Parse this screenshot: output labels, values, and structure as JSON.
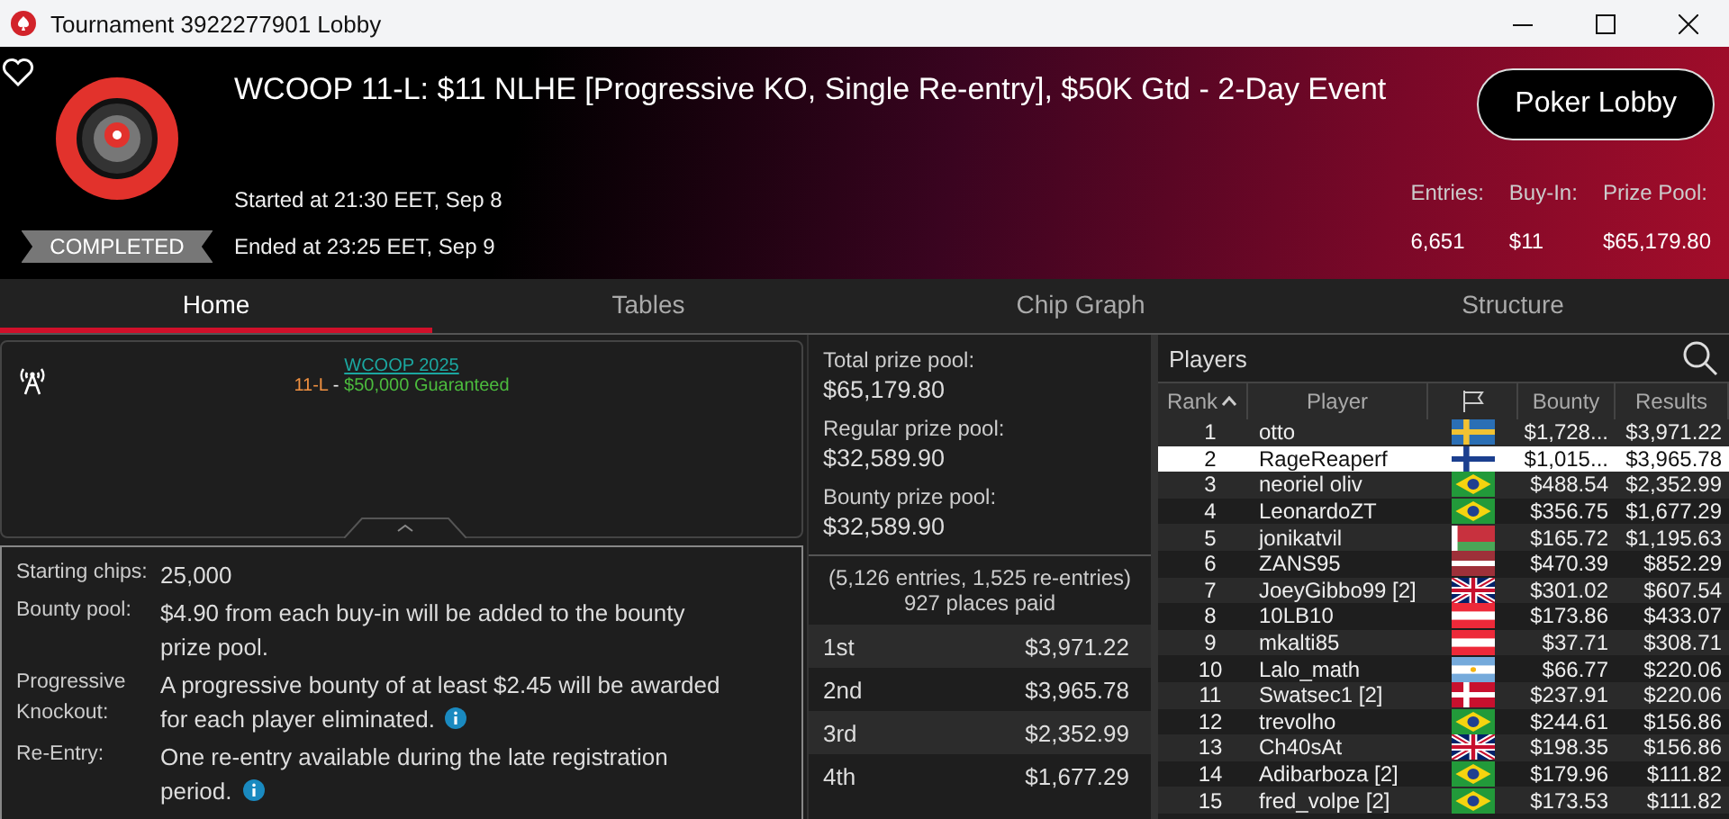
{
  "window": {
    "title": "Tournament 3922277901 Lobby"
  },
  "header": {
    "status": "COMPLETED",
    "title": "WCOOP 11-L: $11 NLHE [Progressive KO, Single Re-entry], $50K Gtd - 2-Day Event",
    "started": "Started at 21:30 EET, Sep 8",
    "ended": "Ended at 23:25 EET, Sep 9",
    "button": "Poker Lobby",
    "stats": [
      {
        "label": "Entries:",
        "value": "6,651"
      },
      {
        "label": "Buy-In:",
        "value": "$11"
      },
      {
        "label": "Prize Pool:",
        "value": "$65,179.80"
      }
    ]
  },
  "tabs": [
    {
      "label": "Home",
      "selected": true
    },
    {
      "label": "Tables",
      "selected": false
    },
    {
      "label": "Chip Graph",
      "selected": false
    },
    {
      "label": "Structure",
      "selected": false
    }
  ],
  "event": {
    "link": "WCOOP 2025",
    "subtitle": [
      {
        "kind": "code",
        "text": "11-L"
      },
      {
        "kind": "sep",
        "text": " - "
      },
      {
        "kind": "guarantee",
        "text": "$50,000 Guaranteed"
      }
    ]
  },
  "details": [
    {
      "label": "Starting chips:",
      "value": "25,000",
      "info": false
    },
    {
      "label": "Bounty pool:",
      "value": "$4.90 from each buy-in will be added to the bounty prize pool.",
      "info": false
    },
    {
      "label": "Progressive Knockout:",
      "value": "A progressive bounty of at least $2.45 will be awarded for each player eliminated.",
      "info": true
    },
    {
      "label": "Re-Entry:",
      "value": "One re-entry available during the late registration period.",
      "info": true
    }
  ],
  "prize_pools": [
    {
      "label": "Total prize pool:",
      "value": "$65,179.80"
    },
    {
      "label": "Regular prize pool:",
      "value": "$32,589.90"
    },
    {
      "label": "Bounty prize pool:",
      "value": "$32,589.90"
    }
  ],
  "entries_note": "(5,126 entries, 1,525 re-entries)",
  "places_paid": "927 places paid",
  "payouts": [
    {
      "place": "1st",
      "amount": "$3,971.22"
    },
    {
      "place": "2nd",
      "amount": "$3,965.78"
    },
    {
      "place": "3rd",
      "amount": "$2,352.99"
    },
    {
      "place": "4th",
      "amount": "$1,677.29"
    }
  ],
  "players": {
    "title": "Players",
    "columns": [
      "Rank",
      "Player",
      "Bounty",
      "Results"
    ],
    "rows": [
      {
        "rank": "1",
        "player": "otto",
        "kind": "se",
        "bounty": "$1,728...",
        "results": "$3,971.22",
        "selected": false
      },
      {
        "rank": "2",
        "player": "RageReaperf",
        "kind": "fi",
        "bounty": "$1,015...",
        "results": "$3,965.78",
        "selected": true
      },
      {
        "rank": "3",
        "player": "neoriel oliv",
        "kind": "br",
        "bounty": "$488.54",
        "results": "$2,352.99",
        "selected": false
      },
      {
        "rank": "4",
        "player": "LeonardoZT",
        "kind": "br",
        "bounty": "$356.75",
        "results": "$1,677.29",
        "selected": false
      },
      {
        "rank": "5",
        "player": "jonikatvil",
        "kind": "by",
        "bounty": "$165.72",
        "results": "$1,195.63",
        "selected": false
      },
      {
        "rank": "6",
        "player": "ZANS95",
        "kind": "lv",
        "bounty": "$470.39",
        "results": "$852.29",
        "selected": false
      },
      {
        "rank": "7",
        "player": "JoeyGibbo99 [2]",
        "kind": "gb",
        "bounty": "$301.02",
        "results": "$607.54",
        "selected": false
      },
      {
        "rank": "8",
        "player": "10LB10",
        "kind": "at",
        "bounty": "$173.86",
        "results": "$433.07",
        "selected": false
      },
      {
        "rank": "9",
        "player": "mkalti85",
        "kind": "at",
        "bounty": "$37.71",
        "results": "$308.71",
        "selected": false
      },
      {
        "rank": "10",
        "player": "Lalo_math",
        "kind": "ar",
        "bounty": "$66.77",
        "results": "$220.06",
        "selected": false
      },
      {
        "rank": "11",
        "player": "Swatsec1 [2]",
        "kind": "dk",
        "bounty": "$237.91",
        "results": "$220.06",
        "selected": false
      },
      {
        "rank": "12",
        "player": "trevolho",
        "kind": "br",
        "bounty": "$244.61",
        "results": "$156.86",
        "selected": false
      },
      {
        "rank": "13",
        "player": "Ch40sAt",
        "kind": "gb",
        "bounty": "$198.35",
        "results": "$156.86",
        "selected": false
      },
      {
        "rank": "14",
        "player": "Adibarboza [2]",
        "kind": "br",
        "bounty": "$179.96",
        "results": "$111.82",
        "selected": false
      },
      {
        "rank": "15",
        "player": "fred_volpe [2]",
        "kind": "br",
        "bounty": "$173.53",
        "results": "$111.82",
        "selected": false
      }
    ]
  }
}
